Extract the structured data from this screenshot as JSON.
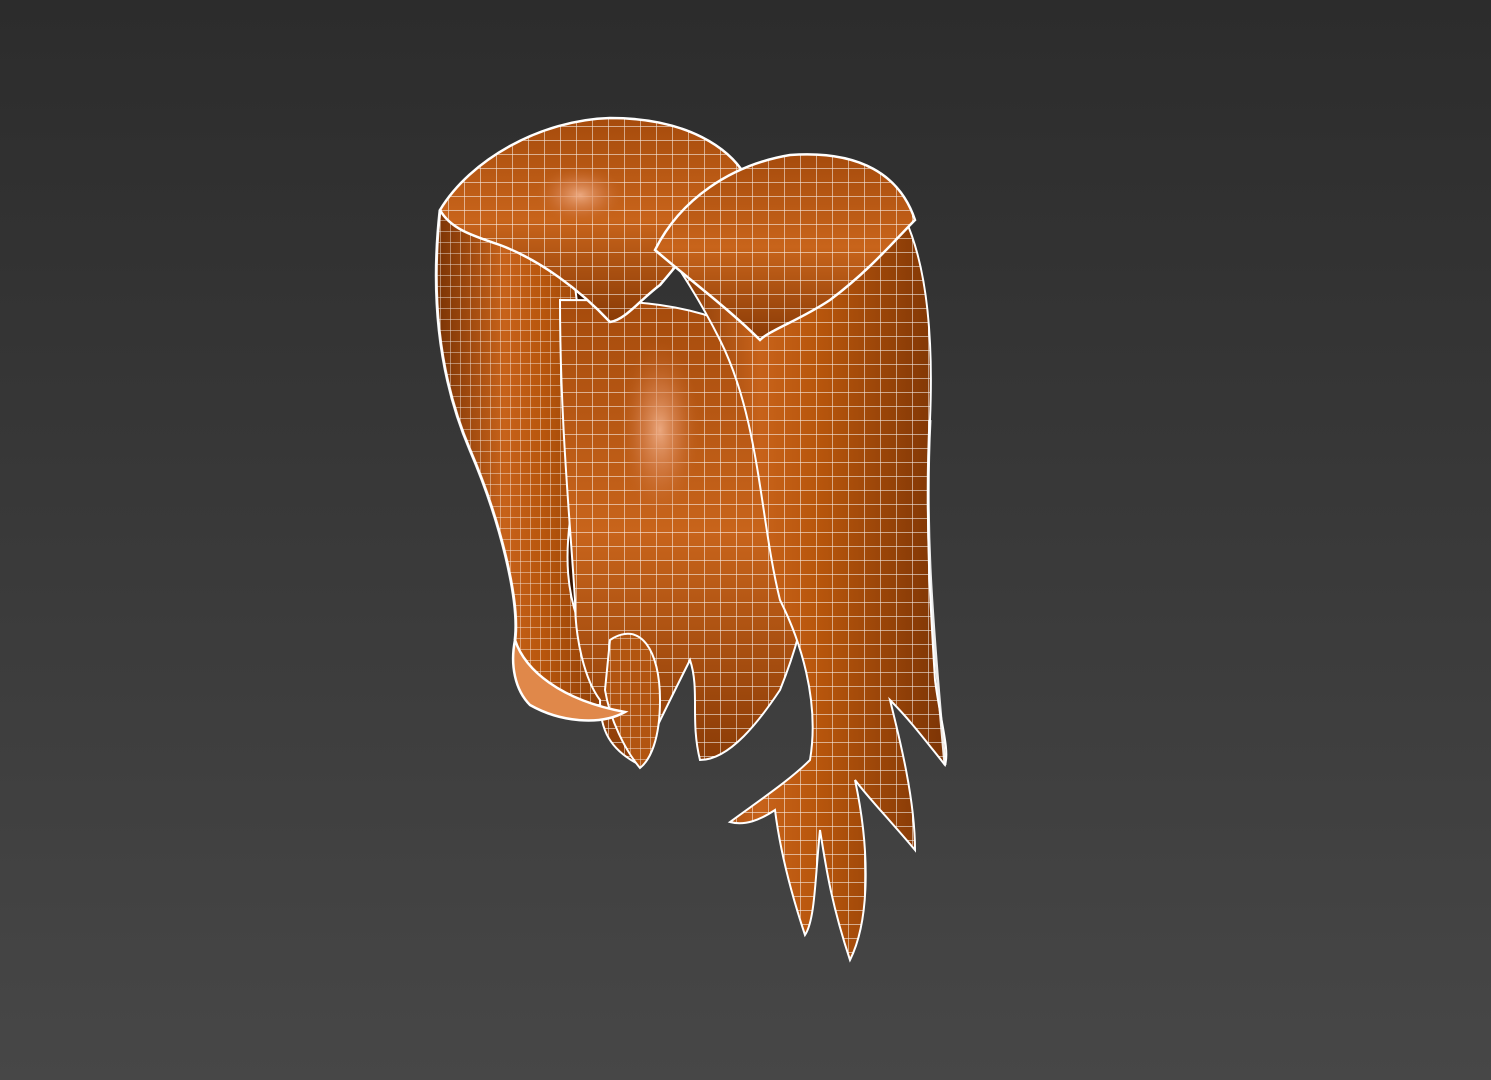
{
  "scene": {
    "subject": "hair-mesh",
    "render_mode": "smooth-shaded-with-wireframe",
    "colors": {
      "background_top": "#2c2c2c",
      "background_bottom": "#474747",
      "hair_base": "#b8560c",
      "hair_dark": "#6a2a02",
      "hair_highlight": "#e8a077",
      "wire": "#ffffff"
    }
  }
}
